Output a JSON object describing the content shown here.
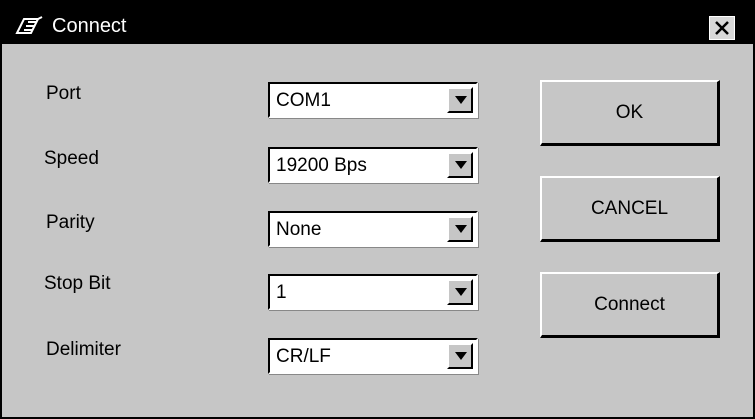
{
  "window": {
    "title": "Connect"
  },
  "fields": [
    {
      "label": "Port",
      "value": "COM1"
    },
    {
      "label": "Speed",
      "value": "19200 Bps"
    },
    {
      "label": "Parity",
      "value": "None"
    },
    {
      "label": "Stop Bit",
      "value": "1"
    },
    {
      "label": "Delimiter",
      "value": "CR/LF"
    }
  ],
  "buttons": {
    "ok": "OK",
    "cancel": "CANCEL",
    "connect": "Connect"
  },
  "icons": {
    "app": "connect-plug-icon",
    "close": "close-icon",
    "dropdown": "chevron-down-icon"
  },
  "colors": {
    "titlebar": "#000000",
    "face": "#c6c6c6",
    "field": "#ffffff"
  }
}
